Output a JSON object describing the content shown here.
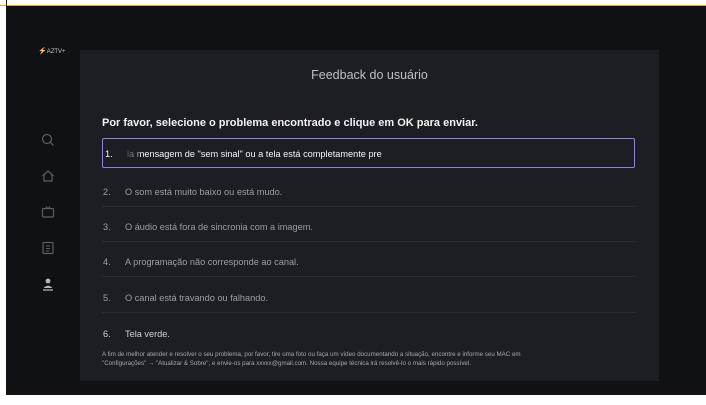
{
  "app": {
    "brand": "AZTV+"
  },
  "dialog": {
    "title": "Feedback do usuário",
    "instruction": "Por favor, selecione o problema encontrado e clique em OK para enviar.",
    "options": [
      {
        "number": "1.",
        "text": "la mensagem de \"sem sinal\" ou a tela está completamente pre",
        "selected": true
      },
      {
        "number": "2.",
        "text": "O som está muito baixo ou está mudo."
      },
      {
        "number": "3.",
        "text": "O áudio está fora de sincronia com a imagem."
      },
      {
        "number": "4.",
        "text": "A programação não corresponde ao canal."
      },
      {
        "number": "5.",
        "text": "O canal está travando ou falhando."
      },
      {
        "number": "6.",
        "text": "Tela verde."
      }
    ],
    "footer_line1": "A fim de melhor atender e resolver o seu problema, por favor, tire uma foto ou faça um vídeo documentando a situação, encontre e informe seu MAC em",
    "footer_line2": "\"Configurações\" → \"Atualizar & Sobre\", e envie-os para xxxxx@gmail.com. Nossa equipe técnica irá resolvê-lo o mais rápido possível."
  },
  "sidebar": {
    "icons": [
      "search-icon",
      "home-icon",
      "tv-icon",
      "guide-icon",
      "user-icon"
    ]
  },
  "colors": {
    "accent_orange": "#f0a02a",
    "selection_border": "#8f82d9",
    "panel_bg": "#1d1e24",
    "screen_bg": "#101114"
  }
}
